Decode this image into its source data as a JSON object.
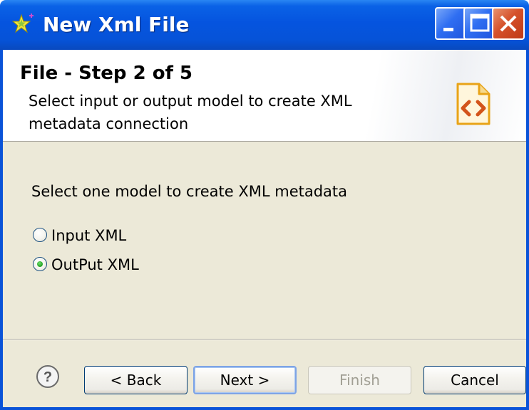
{
  "window": {
    "title": "New Xml File",
    "icon": "star-sparkle-icon",
    "controls": {
      "minimize": "minimize-icon",
      "maximize": "maximize-icon",
      "close": "close-icon"
    }
  },
  "header": {
    "step_title": "File - Step 2 of 5",
    "description": "Select input or output model to create XML metadata connection",
    "icon": "xml-file-icon"
  },
  "content": {
    "prompt": "Select one model to create XML metadata",
    "options": [
      {
        "label": "Input XML",
        "selected": false
      },
      {
        "label": "OutPut XML",
        "selected": true
      }
    ]
  },
  "footer": {
    "help_icon": "help-icon",
    "buttons": {
      "back": "< Back",
      "next": "Next >",
      "finish": "Finish",
      "cancel": "Cancel"
    },
    "finish_enabled": false
  },
  "colors": {
    "titlebar": "#0554df",
    "dialog_background": "#ece9d8",
    "selected_radio": "#21a121",
    "icon_accent": "#e8a317"
  }
}
